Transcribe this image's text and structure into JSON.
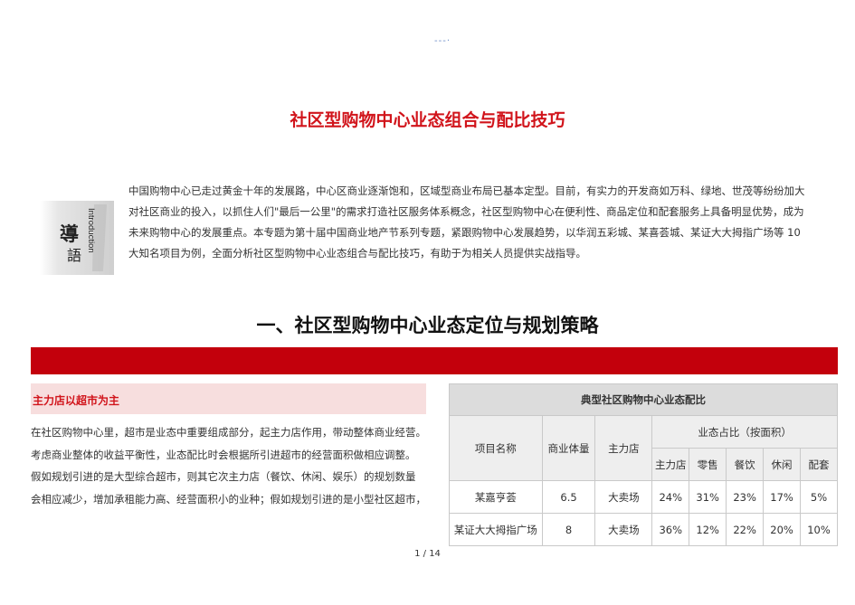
{
  "header": {
    "dots": "---·"
  },
  "doc": {
    "title": "社区型购物中心业态组合与配比技巧",
    "intro_badge": {
      "main_chars": "導語",
      "side_text": "Introduction"
    },
    "intro_lines": [
      "中国购物中心已走过黄金十年的发展路，中心区商业逐渐饱和，区域型商业布局已基本定型。目前，有实力的开发商如万科、绿地、世茂等纷纷加大",
      "对社区商业的投入，以抓住人们\"最后一公里\"的需求打造社区服务体系概念，社区型购物中心在便利性、商品定位和配套服务上具备明显优势，成为",
      "未来购物中心的发展重点。本专题为第十届中国商业地产节系列专题，紧跟购物中心发展趋势，以华润五彩城、某喜荟城、某证大大拇指广场等  10",
      "大知名项目为例，全面分析社区型购物中心业态组合与配比技巧，有助于为相关人员提供实战指导。"
    ],
    "section_title": "一、社区型购物中心业态定位与规划策略",
    "subheading": "主力店以超市为主",
    "body_lines": [
      "在社区购物中心里，超市是业态中重要组成部分，起主力店作用，带动整体商业经营。",
      "考虑商业整体的收益平衡性，业态配比时会根据所引进超市的经营面积做相应调整。",
      "假如规划引进的是大型综合超市，则其它次主力店（餐饮、休闲、娱乐）的规划数量",
      "会相应减少，增加承租能力高、经营面积小的业种；假如规划引进的是小型社区超市，"
    ]
  },
  "table": {
    "caption": "典型社区购物中心业态配比",
    "headers": {
      "project": "项目名称",
      "volume": "商业体量",
      "anchor": "主力店",
      "ratio_group": "业态占比（按面积）",
      "ratio_cols": [
        "主力店",
        "零售",
        "餐饮",
        "休闲",
        "配套"
      ]
    },
    "rows": [
      {
        "name": "某嘉亨荟",
        "volume": "6.5",
        "anchor": "大卖场",
        "ratios": [
          "24%",
          "31%",
          "23%",
          "17%",
          "5%"
        ]
      },
      {
        "name": "某证大大拇指广场",
        "volume": "8",
        "anchor": "大卖场",
        "ratios": [
          "36%",
          "12%",
          "22%",
          "20%",
          "10%"
        ]
      }
    ]
  },
  "footer": {
    "page_current": "1",
    "separator": "/",
    "page_total": "14"
  }
}
